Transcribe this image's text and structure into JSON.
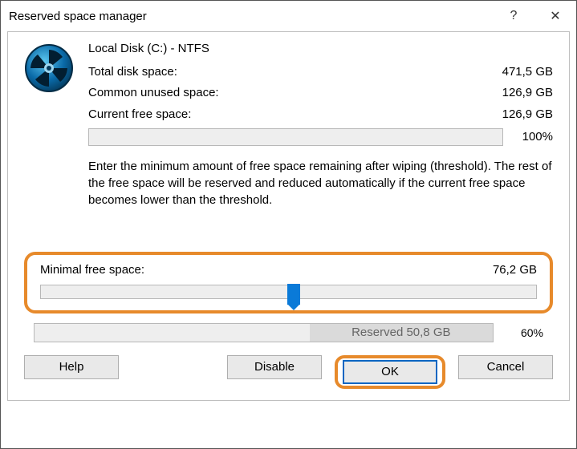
{
  "titlebar": {
    "title": "Reserved space manager",
    "help_glyph": "?",
    "close_glyph": "✕"
  },
  "disk": {
    "name": "Local Disk (C:) - NTFS",
    "total_label": "Total disk space:",
    "total_value": "471,5 GB",
    "unused_label": "Common unused space:",
    "unused_value": "126,9 GB",
    "free_label": "Current free space:",
    "free_value": "126,9 GB",
    "pct": "100%"
  },
  "instructions": "Enter the minimum amount of free space remaining after wiping (threshold). The rest of the free space will be reserved and reduced automatically if the current free space becomes lower than the threshold.",
  "slider": {
    "label": "Minimal free space:",
    "value": "76,2 GB",
    "position_pct": 51
  },
  "reserved": {
    "label": "Reserved 50,8 GB",
    "fill_pct": 40,
    "pct": "60%"
  },
  "buttons": {
    "help": "Help",
    "disable": "Disable",
    "ok": "OK",
    "cancel": "Cancel"
  },
  "colors": {
    "accent_blue": "#0a7ad8",
    "highlight_orange": "#e78a2b"
  }
}
